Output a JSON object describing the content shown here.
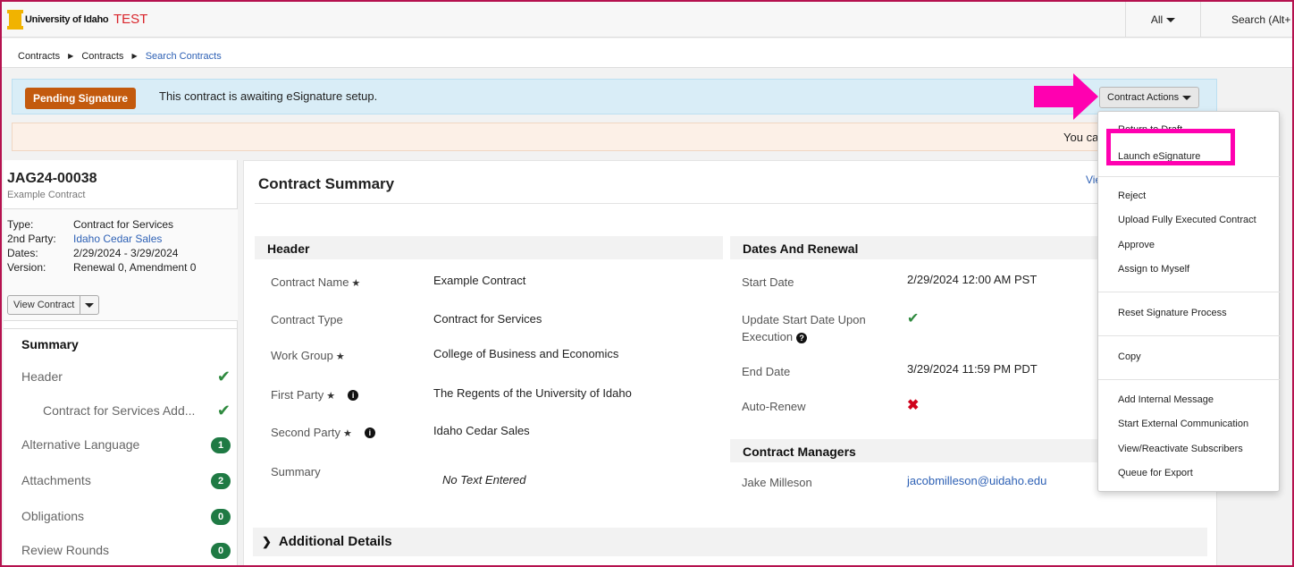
{
  "app": {
    "logo_text": "University of Idaho",
    "env_label": "TEST"
  },
  "topbar": {
    "scope": "All",
    "search_label": "Search (Alt+"
  },
  "breadcrumb": [
    "Contracts",
    "Contracts",
    "Search Contracts"
  ],
  "status": {
    "badge": "Pending Signature",
    "message": "This contract is awaiting eSignature setup.",
    "actions_button": "Contract Actions"
  },
  "warning": {
    "text": "You canno"
  },
  "contract": {
    "id": "JAG24-00038",
    "name": "Example Contract",
    "meta": [
      {
        "k": "Type:",
        "v": "Contract for Services"
      },
      {
        "k": "2nd Party:",
        "v": "Idaho Cedar Sales"
      },
      {
        "k": "Dates:",
        "v": "2/29/2024 - 3/29/2024"
      },
      {
        "k": "Version:",
        "v": "Renewal 0, Amendment 0"
      }
    ],
    "view_button": "View Contract"
  },
  "nav": {
    "summary": "Summary",
    "items": [
      {
        "label": "Header",
        "check": "✔"
      },
      {
        "label": "Contract for Services Add...",
        "check": "✔"
      },
      {
        "label": "Alternative Language",
        "count": "1"
      },
      {
        "label": "Attachments",
        "count": "2"
      },
      {
        "label": "Obligations",
        "count": "0"
      },
      {
        "label": "Review Rounds",
        "count": "0"
      }
    ]
  },
  "main": {
    "title": "Contract Summary",
    "view_link": "Vie",
    "header_section": {
      "title": "Header",
      "fields": [
        {
          "label": "Contract Name",
          "value": "Example Contract"
        },
        {
          "label": "Contract Type",
          "value": "Contract for Services"
        },
        {
          "label": "Work Group",
          "value": "College of Business and Economics"
        },
        {
          "label": "First Party",
          "value": "The Regents of the University of Idaho"
        },
        {
          "label": "Second Party",
          "value": "Idaho Cedar Sales"
        },
        {
          "label": "Summary",
          "value": "No Text Entered"
        }
      ]
    },
    "dates_section": {
      "title": "Dates And Renewal",
      "start_label": "Start Date",
      "start_value": "2/29/2024 12:00 AM PST",
      "update_label_1": "Update Start Date Upon",
      "update_label_2": "Execution",
      "end_label": "End Date",
      "end_value": "3/29/2024 11:59 PM PDT",
      "auto_label": "Auto-Renew"
    },
    "managers_section": {
      "title": "Contract Managers",
      "name": "Jake Milleson",
      "email": "jacobmilleson@uidaho.edu"
    },
    "additional": "Additional Details"
  },
  "menu": {
    "items": [
      "Return to Draft",
      "Launch eSignature",
      "Reject",
      "Upload Fully Executed Contract",
      "Approve",
      "Assign to Myself",
      "Reset Signature Process",
      "Copy",
      "Add Internal Message",
      "Start External Communication",
      "View/Reactivate Subscribers",
      "Queue for Export"
    ]
  },
  "colors": {
    "annotation": "#ff00b0",
    "badge": "#c35a0e",
    "link": "#2e61b5"
  }
}
